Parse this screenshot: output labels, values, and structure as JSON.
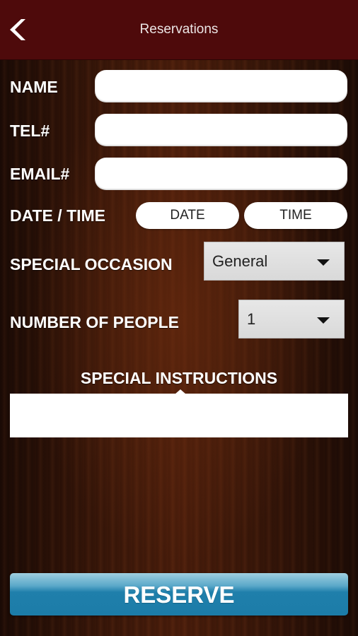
{
  "header": {
    "title": "Reservations",
    "back_icon": "chevron-left-icon",
    "background_color": "#4e0a0b"
  },
  "form": {
    "name_label": "NAME",
    "name_value": "",
    "tel_label": "TEL#",
    "tel_value": "",
    "email_label": "EMAIL#",
    "email_value": "",
    "datetime_label": "DATE / TIME",
    "date_button": "DATE",
    "time_button": "TIME",
    "occasion_label": "SPECIAL OCCASION",
    "occasion_selected": "General",
    "people_label": "NUMBER OF PEOPLE",
    "people_selected": "1",
    "instructions_label": "SPECIAL INSTRUCTIONS",
    "instructions_value": ""
  },
  "actions": {
    "reserve_label": "RESERVE",
    "reserve_color": "#1c7ca8"
  }
}
